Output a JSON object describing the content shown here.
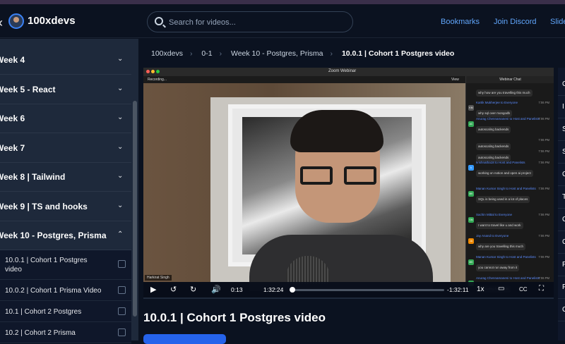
{
  "header": {
    "brand": "100xdevs",
    "search_placeholder": "Search for videos...",
    "nav": [
      "Bookmarks",
      "Join Discord",
      "Slide"
    ]
  },
  "sidebar": {
    "items": [
      {
        "label": "Week 4",
        "expanded": false
      },
      {
        "label": "Week 5 - React",
        "expanded": false
      },
      {
        "label": "Week 6",
        "expanded": false
      },
      {
        "label": "Week 7",
        "expanded": false
      },
      {
        "label": "Week 8 | Tailwind",
        "expanded": false
      },
      {
        "label": "Week 9 | TS and hooks",
        "expanded": false
      },
      {
        "label": "Week 10 - Postgres, Prisma",
        "expanded": true
      }
    ],
    "sub_items": [
      {
        "label": "10.0.1 | Cohort 1 Postgres video",
        "checked": false
      },
      {
        "label": "10.0.2 | Cohort 1 Prisma Video",
        "checked": false
      },
      {
        "label": "10.1 | Cohort 2 Postgres",
        "checked": false
      },
      {
        "label": "10.2 | Cohort 2 Prisma",
        "checked": false
      }
    ]
  },
  "breadcrumb": [
    "100xdevs",
    "0-1",
    "Week 10 - Postgres, Prisma",
    "10.0.1 | Cohort 1 Postgres video"
  ],
  "video": {
    "window_title": "Zoom Webinar",
    "recording_label": "Recording...",
    "view_label": "View",
    "speaker_name": "Harkirat Singh",
    "chat_title": "Webinar Chat",
    "chat": [
      {
        "who": "",
        "text": "why how are you travelling this much",
        "time": ""
      },
      {
        "who": "Kartik Mukherjee to Everyone",
        "text": "why sql over mongodb",
        "time": "7:06 PM",
        "avatar": "KM",
        "color": "#555"
      },
      {
        "who": "Anurag Chennamaneni to Host and Panelists",
        "text": "autoscaling backends",
        "time": "7:06 PM",
        "avatar": "AC",
        "color": "#3a5"
      },
      {
        "who": "",
        "text": "autoscaling backends",
        "time": "7:06 PM"
      },
      {
        "who": "",
        "text": "autoscaling backends",
        "time": "7:06 PM"
      },
      {
        "who": "krishnatha18 to Host and Panelists",
        "text": "working on notion and open ai project",
        "time": "7:06 PM",
        "avatar": "k",
        "color": "#39f"
      },
      {
        "who": "Manan Kumar Singh to Host and Panelists",
        "text": "SQL is being used in a lot of places",
        "time": "7:06 PM",
        "avatar": "MK",
        "color": "#3a5"
      },
      {
        "who": "Sachin Mittal to Everyone",
        "text": "I want to travel like u and work",
        "time": "7:06 PM",
        "avatar": "SM",
        "color": "#3a5"
      },
      {
        "who": "Jay Anand to Everyone",
        "text": "why are you travelling this much",
        "time": "7:06 PM",
        "avatar": "JA",
        "color": "#e80"
      },
      {
        "who": "Manan Kumar Singh to Host and Panelists",
        "text": "you cannot run away from it",
        "time": "7:06 PM",
        "avatar": "MK",
        "color": "#3a5"
      },
      {
        "who": "Anurag Chennamaneni to Host and Panelists",
        "text": "autoscaling backends",
        "time": "7:06 PM",
        "avatar": "AC",
        "color": "#3a5"
      }
    ],
    "current_time": "0:13",
    "duration": "1:32:24",
    "remaining": "-1:32:11",
    "progress_fraction": 0.0023,
    "speed": "1x"
  },
  "page_title": "10.0.1 | Cohort 1 Postgres video",
  "right_panel_letters": [
    "C",
    "I",
    "S",
    "S",
    "C",
    "T",
    "C",
    "C",
    "F",
    "F",
    "C"
  ]
}
